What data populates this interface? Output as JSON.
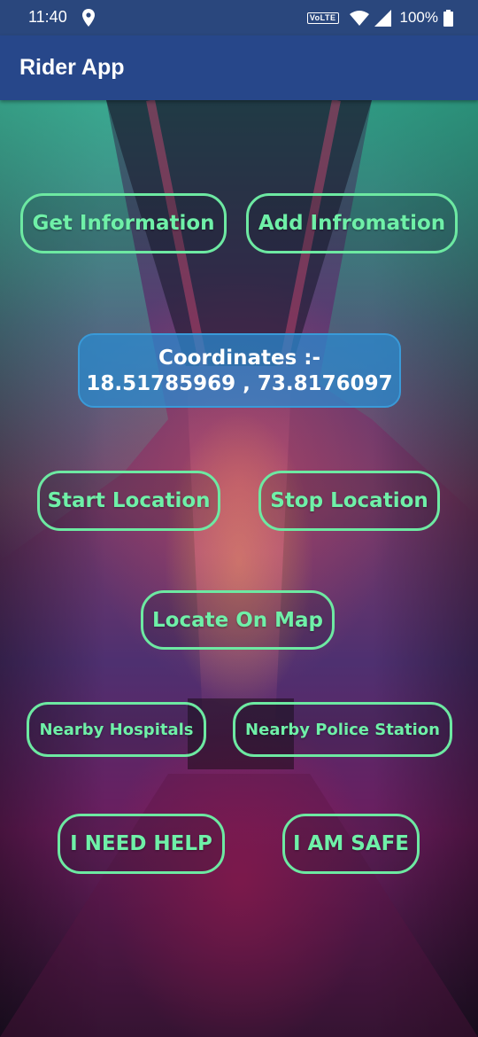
{
  "status_bar": {
    "time": "11:40",
    "network_badge": "VoLTE",
    "battery": "100%",
    "icons": [
      "location-pin-icon",
      "wifi-icon",
      "cell-signal-icon",
      "battery-icon"
    ]
  },
  "app_bar": {
    "title": "Rider App"
  },
  "buttons": {
    "get_information": "Get Information",
    "add_information": "Add Infromation",
    "start_location": "Start Location",
    "stop_location": "Stop Location",
    "locate_on_map": "Locate On Map",
    "nearby_hospitals": "Nearby Hospitals",
    "nearby_police_station": "Nearby Police Station",
    "i_need_help": "I NEED HELP",
    "i_am_safe": "I AM SAFE"
  },
  "coordinates": {
    "label": "Coordinates :-",
    "value": "18.51785969 , 73.8176097"
  },
  "colors": {
    "status_bar": "#2a477d",
    "app_bar": "#27478a",
    "button_accent": "#6de9a2",
    "coordinates_box": "#2e8cd2"
  }
}
